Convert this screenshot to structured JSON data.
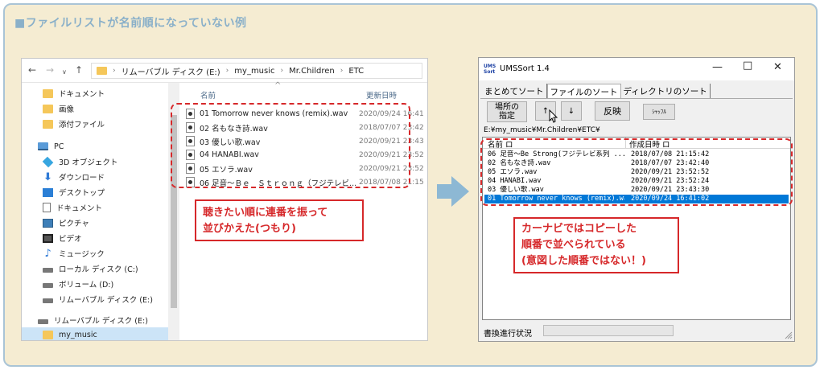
{
  "heading": "■ファイルリストが名前順になっていない例",
  "explorer": {
    "breadcrumbs": [
      "リムーバブル ディスク (E:)",
      "my_music",
      "Mr.Children",
      "ETC"
    ],
    "nav_items": [
      {
        "label": "ドキュメント",
        "icon": "folder-icon"
      },
      {
        "label": "画像",
        "icon": "folder-icon"
      },
      {
        "label": "添付ファイル",
        "icon": "folder-icon"
      },
      {
        "label": "PC",
        "icon": "pc-icon"
      },
      {
        "label": "3D オブジェクト",
        "icon": "3d-objects-icon"
      },
      {
        "label": "ダウンロード",
        "icon": "download-icon"
      },
      {
        "label": "デスクトップ",
        "icon": "desktop-icon"
      },
      {
        "label": "ドキュメント",
        "icon": "document-icon"
      },
      {
        "label": "ピクチャ",
        "icon": "pictures-icon"
      },
      {
        "label": "ビデオ",
        "icon": "videos-icon"
      },
      {
        "label": "ミュージック",
        "icon": "music-icon"
      },
      {
        "label": "ローカル ディスク (C:)",
        "icon": "drive-icon"
      },
      {
        "label": "ボリューム (D:)",
        "icon": "drive-icon"
      },
      {
        "label": "リムーバブル ディスク (E:)",
        "icon": "drive-icon"
      },
      {
        "label": "リムーバブル ディスク (E:)",
        "icon": "drive-icon"
      },
      {
        "label": "my_music",
        "icon": "folder-icon"
      }
    ],
    "columns": {
      "name": "名前",
      "date": "更新日時"
    },
    "files": [
      {
        "name": "01 Tomorrow never knows (remix).wav",
        "date": "2020/09/24 16:41"
      },
      {
        "name": "02 名もなき詩.wav",
        "date": "2018/07/07 23:42"
      },
      {
        "name": "03 優しい歌.wav",
        "date": "2020/09/21 23:43"
      },
      {
        "name": "04 HANABI.wav",
        "date": "2020/09/21 23:52"
      },
      {
        "name": "05 エソラ.wav",
        "date": "2020/09/21 23:52"
      },
      {
        "name": "06 足音～Ｂｅ　Ｓｔｒｏｎｇ（フジテレビ...",
        "date": "2018/07/08 21:15"
      }
    ],
    "callout_line1": "聴きたい順に連番を振って",
    "callout_line2": "並びかえた(つもり)"
  },
  "ums": {
    "title": "UMSSort 1.4",
    "app_icon_text": "UMS Sort",
    "tabs": [
      "まとめてソート",
      "ファイルのソート",
      "ディレクトリのソート"
    ],
    "buttons": {
      "location_line1": "場所の",
      "location_line2": "指定",
      "up": "↑",
      "down": "↓",
      "reflect": "反映",
      "shuffle": "ｼｬｯﾌﾙ"
    },
    "path": "E:¥my_music¥Mr.Children¥ETC¥",
    "columns": {
      "name": "名前 ロ",
      "date": "作成日時 ロ"
    },
    "rows": [
      {
        "name": "06 足音～Be Strong(フジテレビ系列 ...",
        "date": "2018/07/08 21:15:42",
        "selected": false
      },
      {
        "name": "02 名もなき詩.wav",
        "date": "2018/07/07 23:42:40",
        "selected": false
      },
      {
        "name": "05 エソラ.wav",
        "date": "2020/09/21 23:52:52",
        "selected": false
      },
      {
        "name": "04 HANABI.wav",
        "date": "2020/09/21 23:52:24",
        "selected": false
      },
      {
        "name": "03 優しい歌.wav",
        "date": "2020/09/21 23:43:30",
        "selected": false
      },
      {
        "name": "01 Tomorrow never knows (remix).wav",
        "date": "2020/09/24 16:41:02",
        "selected": true
      }
    ],
    "status_label": "書換進行状況",
    "callout_line1": "カーナビではコピーした",
    "callout_line2": "順番で並べられている",
    "callout_line3": "(意図した順番ではない！)"
  },
  "colors": {
    "panel_bg": "#f5ecd2",
    "panel_border": "#a9c4d6",
    "accent_red": "#d6282a",
    "selection_blue": "#0078d7"
  }
}
